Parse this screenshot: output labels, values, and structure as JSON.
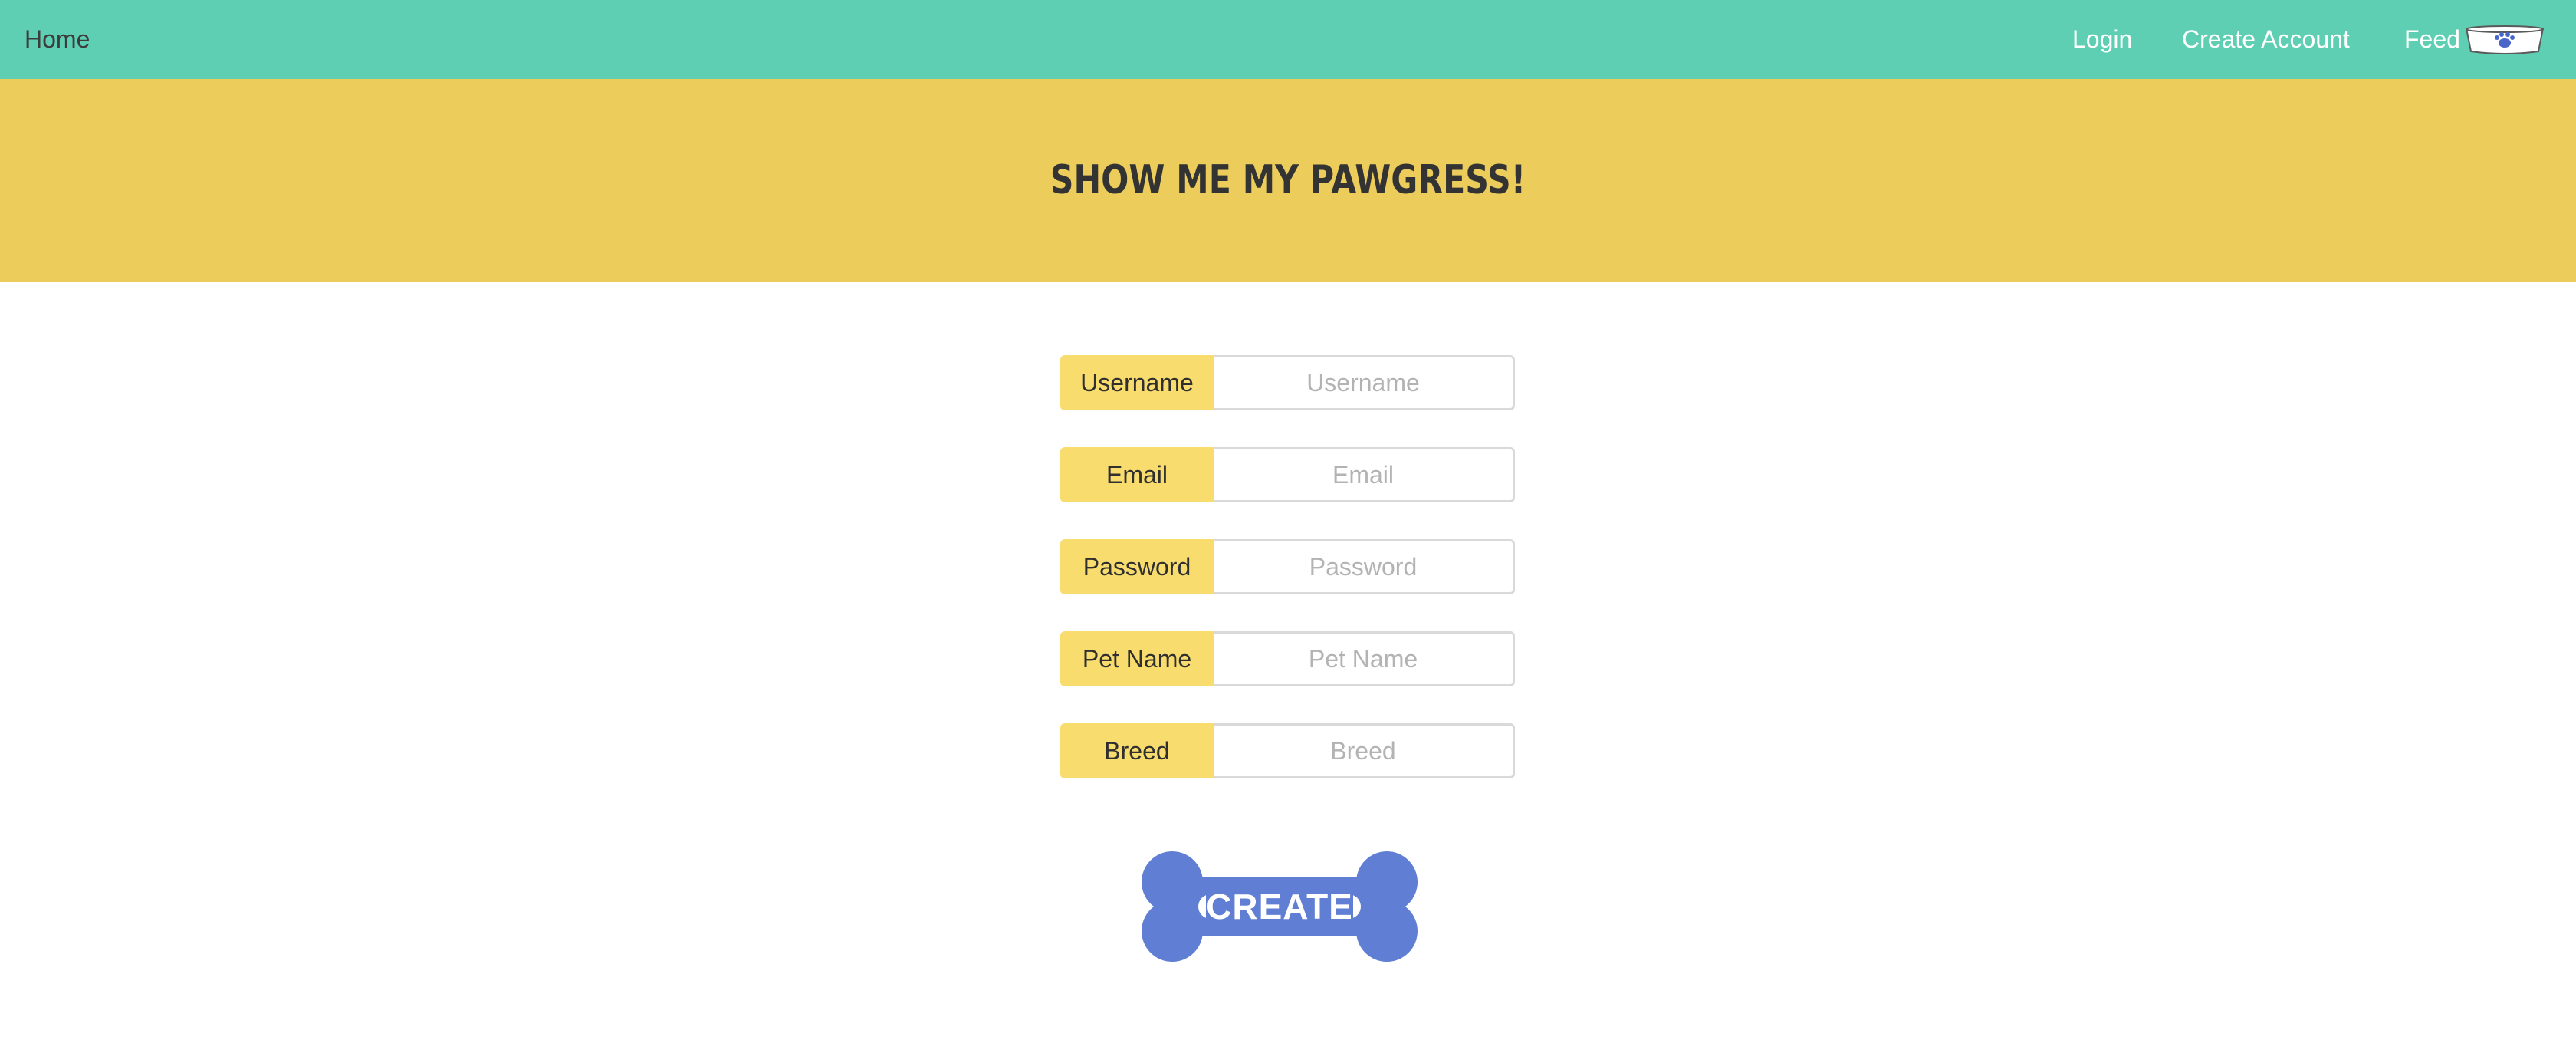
{
  "nav": {
    "home": "Home",
    "login": "Login",
    "create_account": "Create Account",
    "feed": "Feed",
    "feed_icon": "pet-bowl-paw-icon"
  },
  "banner": {
    "title": "SHOW ME MY PAWGRESS!"
  },
  "form": {
    "fields": [
      {
        "label": "Username",
        "placeholder": "Username",
        "value": ""
      },
      {
        "label": "Email",
        "placeholder": "Email",
        "value": ""
      },
      {
        "label": "Password",
        "placeholder": "Password",
        "value": ""
      },
      {
        "label": "Pet Name",
        "placeholder": "Pet Name",
        "value": ""
      },
      {
        "label": "Breed",
        "placeholder": "Breed",
        "value": ""
      }
    ],
    "submit_label": "CREATE",
    "submit_icon": "bone-shape"
  },
  "colors": {
    "navbar": "#5fcfb3",
    "banner": "#eccc5b",
    "label_bg": "#f8dc6e",
    "button": "#5f7ed4"
  }
}
